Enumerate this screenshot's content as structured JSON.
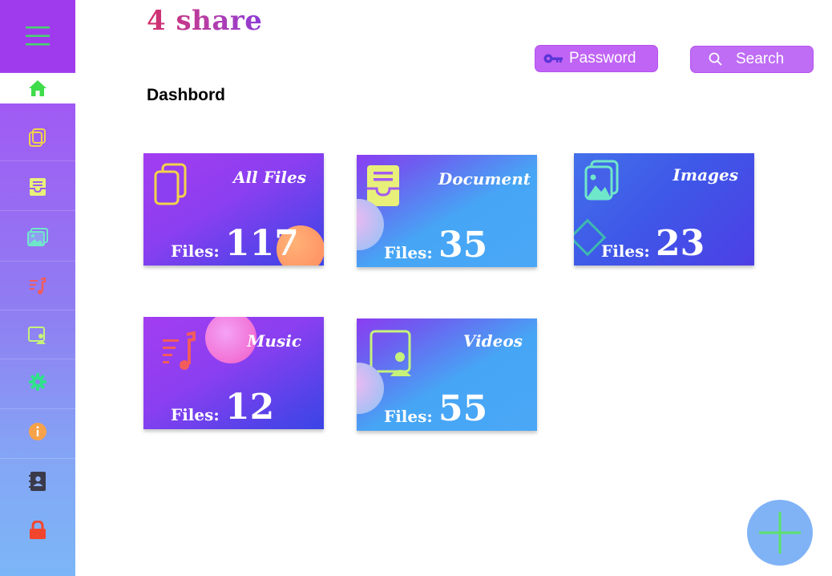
{
  "app": {
    "logo": "4 share"
  },
  "sidebar": {
    "items": [
      {
        "icon": "home-icon",
        "color": "#3fdc4a"
      },
      {
        "icon": "copy-icon",
        "color": "#f1d34a"
      },
      {
        "icon": "inbox-icon",
        "color": "#e8f07a"
      },
      {
        "icon": "images-icon",
        "color": "#6fe7c9"
      },
      {
        "icon": "music-icon",
        "color": "#f25c5c"
      },
      {
        "icon": "video-user-icon",
        "color": "#c6f27a"
      },
      {
        "icon": "gear-icon",
        "color": "#2fe28a"
      },
      {
        "icon": "info-icon",
        "color": "#f6a24a"
      },
      {
        "icon": "contacts-icon",
        "color": "#3a3a4a"
      },
      {
        "icon": "lock-icon",
        "color": "#f2452e"
      }
    ]
  },
  "header": {
    "password_label": "Password",
    "search_label": "Search"
  },
  "main": {
    "title": "Dashbord",
    "files_label": "Files:",
    "cards": [
      {
        "title": "All Files",
        "count": "117"
      },
      {
        "title": "Document",
        "count": "35"
      },
      {
        "title": "Images",
        "count": "23"
      },
      {
        "title": "Music",
        "count": "12"
      },
      {
        "title": "Videos",
        "count": "55"
      }
    ]
  },
  "colors": {
    "accent": "#a03bed",
    "pill": "#c064f5",
    "fab": "#80b3f6",
    "fab_plus": "#5be06a"
  }
}
